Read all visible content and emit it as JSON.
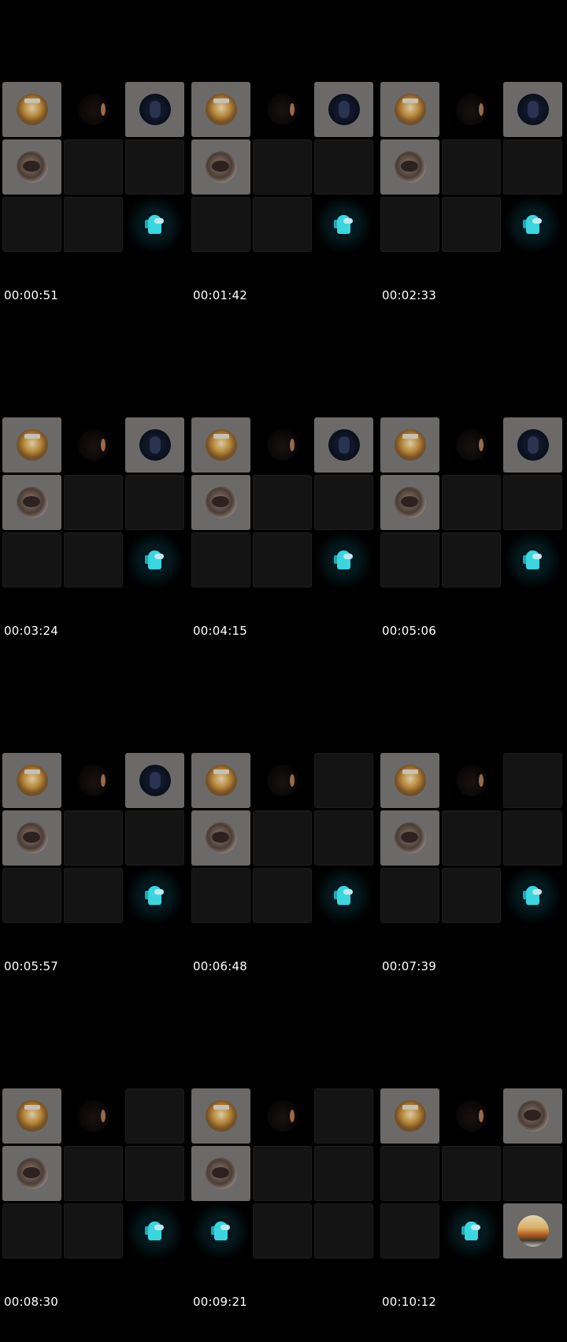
{
  "frames": [
    {
      "timestamp": "00:00:51",
      "tiles": [
        "jar",
        "hood",
        "astro",
        "crow",
        "empty",
        "empty",
        "empty",
        "empty",
        "amongus"
      ]
    },
    {
      "timestamp": "00:01:42",
      "tiles": [
        "jar",
        "hood",
        "astro",
        "crow",
        "empty",
        "empty",
        "empty",
        "empty",
        "amongus"
      ]
    },
    {
      "timestamp": "00:02:33",
      "tiles": [
        "jar",
        "hood",
        "astro",
        "crow",
        "empty",
        "empty",
        "empty",
        "empty",
        "amongus"
      ]
    },
    {
      "timestamp": "00:03:24",
      "tiles": [
        "jar",
        "hood",
        "astro",
        "crow",
        "empty",
        "empty",
        "empty",
        "empty",
        "amongus"
      ]
    },
    {
      "timestamp": "00:04:15",
      "tiles": [
        "jar",
        "hood",
        "astro",
        "crow",
        "empty",
        "empty",
        "empty",
        "empty",
        "amongus"
      ]
    },
    {
      "timestamp": "00:05:06",
      "tiles": [
        "jar",
        "hood",
        "astro",
        "crow",
        "empty",
        "empty",
        "empty",
        "empty",
        "amongus"
      ]
    },
    {
      "timestamp": "00:05:57",
      "tiles": [
        "jar",
        "hood",
        "astro",
        "crow",
        "empty",
        "empty",
        "empty",
        "empty",
        "amongus"
      ]
    },
    {
      "timestamp": "00:06:48",
      "tiles": [
        "jar",
        "hood",
        "empty",
        "crow",
        "empty",
        "empty",
        "empty",
        "empty",
        "amongus"
      ]
    },
    {
      "timestamp": "00:07:39",
      "tiles": [
        "jar",
        "hood",
        "empty",
        "crow",
        "empty",
        "empty",
        "empty",
        "empty",
        "amongus"
      ]
    },
    {
      "timestamp": "00:08:30",
      "tiles": [
        "jar",
        "hood",
        "empty",
        "crow",
        "empty",
        "empty",
        "empty",
        "empty",
        "amongus"
      ]
    },
    {
      "timestamp": "00:09:21",
      "tiles": [
        "jar",
        "hood",
        "empty",
        "crow",
        "empty",
        "empty",
        "amongus",
        "empty",
        "empty"
      ]
    },
    {
      "timestamp": "00:10:12",
      "tiles": [
        "jar",
        "hood",
        "crow",
        "empty",
        "empty",
        "empty",
        "empty",
        "amongus",
        "sunset"
      ]
    }
  ],
  "avatar_icons": {
    "jar": "jar-avatar-icon",
    "hood": "hooded-figure-avatar-icon",
    "astro": "astronaut-avatar-icon",
    "crow": "crow-avatar-icon",
    "amongus": "among-us-crewmate-avatar-icon",
    "sunset": "sunset-landscape-avatar-icon"
  },
  "colors": {
    "background": "#000000",
    "tile_empty": "#141414",
    "tile_gray": "#6b6a68",
    "crewmate": "#39d6e0",
    "timestamp_text": "#ffffff"
  }
}
